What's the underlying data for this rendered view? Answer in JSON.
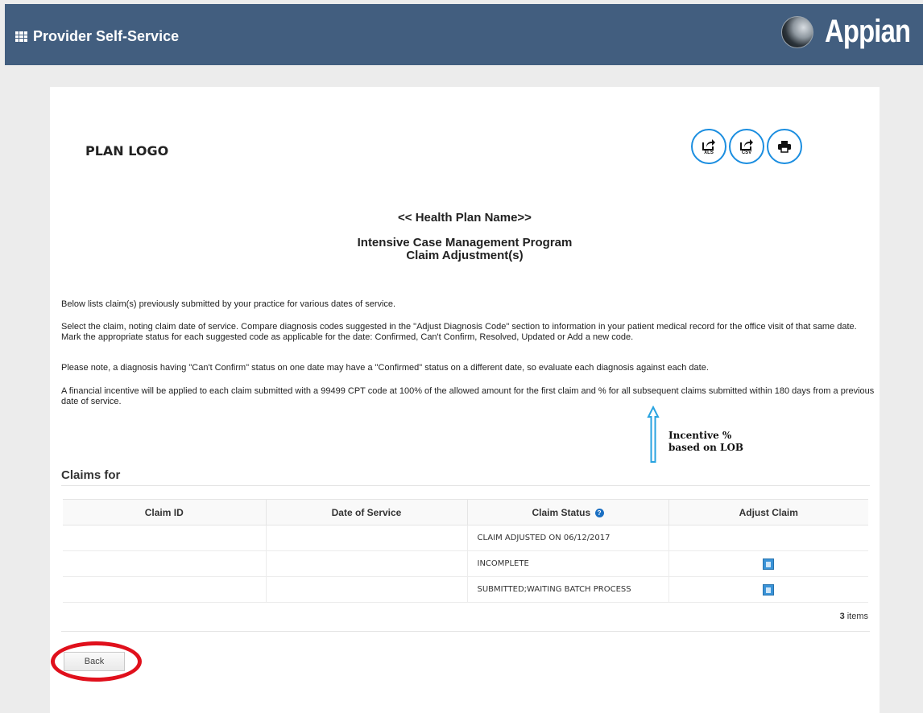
{
  "header": {
    "app_title": "Provider Self-Service",
    "brand_logo_text": "Appian",
    "bg_color": "#425e7f"
  },
  "card": {
    "plan_logo": "PLAN LOGO",
    "export_buttons": [
      {
        "label": "XLS",
        "icon": "export-icon"
      },
      {
        "label": "CSV",
        "icon": "export-icon"
      },
      {
        "label": "",
        "icon": "print-icon"
      }
    ],
    "plan_name": "<< Health Plan Name>>",
    "program_title_line1": "Intensive Case Management Program",
    "program_title_line2": "Claim Adjustment(s)",
    "paragraphs": [
      "Below lists claim(s) previously submitted by your practice for various dates of service.",
      "Select the claim, noting claim date of service. Compare diagnosis codes suggested in the \"Adjust Diagnosis Code\" section to information in your patient medical record for the office visit of that same date. Mark the appropriate status for each suggested code as applicable for the date: Confirmed, Can't Confirm, Resolved, Updated or Add a new code.",
      "Please note, a diagnosis having \"Can't Confirm\" status on one date may have a \"Confirmed\" status on a different date, so evaluate each diagnosis against each date.",
      "A financial incentive will be applied to each claim submitted with a 99499 CPT code at 100% of the allowed amount for the first claim and        % for all subsequent claims submitted within 180 days from a previous date of service."
    ],
    "annotation_line1": "Incentive %",
    "annotation_line2": "based on LOB"
  },
  "claims": {
    "heading": "Claims for",
    "columns": [
      "Claim ID",
      "Date of Service",
      "Claim Status",
      "Adjust Claim"
    ],
    "rows": [
      {
        "claim_id": "",
        "date": "",
        "status": "CLAIM ADJUSTED ON 06/12/2017"
      },
      {
        "claim_id": "",
        "date": "",
        "status": "INCOMPLETE"
      },
      {
        "claim_id": "",
        "date": "",
        "status": "SUBMITTED;WAITING BATCH PROCESS"
      }
    ],
    "count_number": "3",
    "count_label": "items"
  },
  "footer": {
    "back_label": "Back",
    "highlight_color": "#e0101c"
  }
}
